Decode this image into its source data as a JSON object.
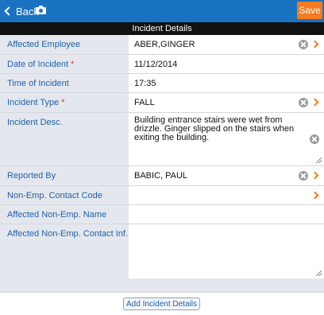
{
  "header": {
    "back_label": "Back",
    "save_label": "Save"
  },
  "section": {
    "title": "Incident Details"
  },
  "form": {
    "affected_employee": {
      "label": "Affected Employee",
      "value": "ABER,GINGER"
    },
    "date_of_incident": {
      "label": "Date of Incident",
      "required": "*",
      "value": "11/12/2014"
    },
    "time_of_incident": {
      "label": "Time of Incident",
      "value": "17:35"
    },
    "incident_type": {
      "label": "Incident Type",
      "required": "*",
      "value": "FALL"
    },
    "incident_desc": {
      "label": "Incident Desc.",
      "value": "Building entrance stairs were wet from drizzle. Ginger slipped on the stairs when exiting the building."
    },
    "reported_by": {
      "label": "Reported By",
      "value": "BABIC, PAUL"
    },
    "non_emp_contact_code": {
      "label": "Non-Emp. Contact Code",
      "value": ""
    },
    "affected_non_emp_name": {
      "label": "Affected Non-Emp. Name",
      "value": ""
    },
    "affected_non_emp_contact_inf": {
      "label": "Affected Non-Emp. Contact Inf.",
      "value": ""
    }
  },
  "footer": {
    "add_button_label": "Add Incident Details"
  },
  "colors": {
    "topbar": "#1a73c0",
    "accent": "#f47b20",
    "label_text": "#1f5fa8",
    "required": "#e4312a",
    "section_header": "#111111"
  },
  "icons": {
    "back": "chevron-left-icon",
    "camera": "camera-icon",
    "clear": "clear-icon",
    "navigate": "chevron-right-icon"
  }
}
